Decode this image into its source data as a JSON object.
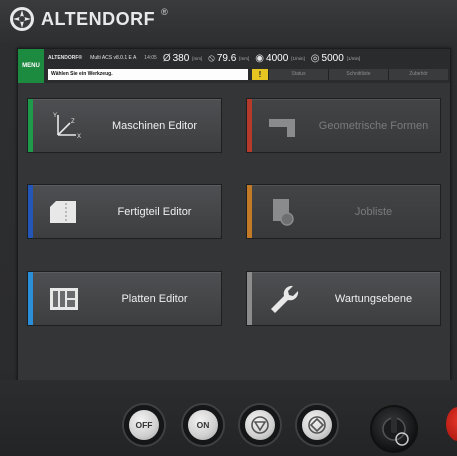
{
  "header": {
    "brand": "ALTENDORF",
    "registered": "®"
  },
  "screen": {
    "menu_label": "MENU",
    "status": {
      "brand": "ALTENDORF®",
      "model": "Multi ACS v8.0.1 E A",
      "time": "14:05",
      "measurements": [
        {
          "icon": "diameter-icon",
          "symbol": "Ø",
          "value": "380",
          "unit": "[mm]"
        },
        {
          "icon": "tilt-saw-icon",
          "symbol": "⦸",
          "value": "79.6",
          "unit": "[mm]"
        },
        {
          "icon": "blade-icon",
          "symbol": "◉",
          "value": "4000",
          "unit": "[1/min]"
        },
        {
          "icon": "scoring-icon",
          "symbol": "◎",
          "value": "5000",
          "unit": "[1/min]"
        }
      ],
      "message": "Wählen Sie ein Werkzeug.",
      "warning_symbol": "!",
      "tabs": [
        "Status",
        "Schnittliste",
        "Zubehör"
      ]
    },
    "tiles": [
      {
        "label": "Maschinen Editor",
        "accent": "#1f9a4a",
        "enabled": true
      },
      {
        "label": "Geometrische Formen",
        "accent": "#b43a2c",
        "enabled": false
      },
      {
        "label": "Fertigteil Editor",
        "accent": "#2456b8",
        "enabled": true
      },
      {
        "label": "Jobliste",
        "accent": "#c27a26",
        "enabled": false
      },
      {
        "label": "Platten Editor",
        "accent": "#2a8ed8",
        "enabled": true
      },
      {
        "label": "Wartungsebene",
        "accent": "#8c8c8c",
        "enabled": true
      }
    ]
  },
  "panel": {
    "off_label": "OFF",
    "on_label": "ON"
  }
}
